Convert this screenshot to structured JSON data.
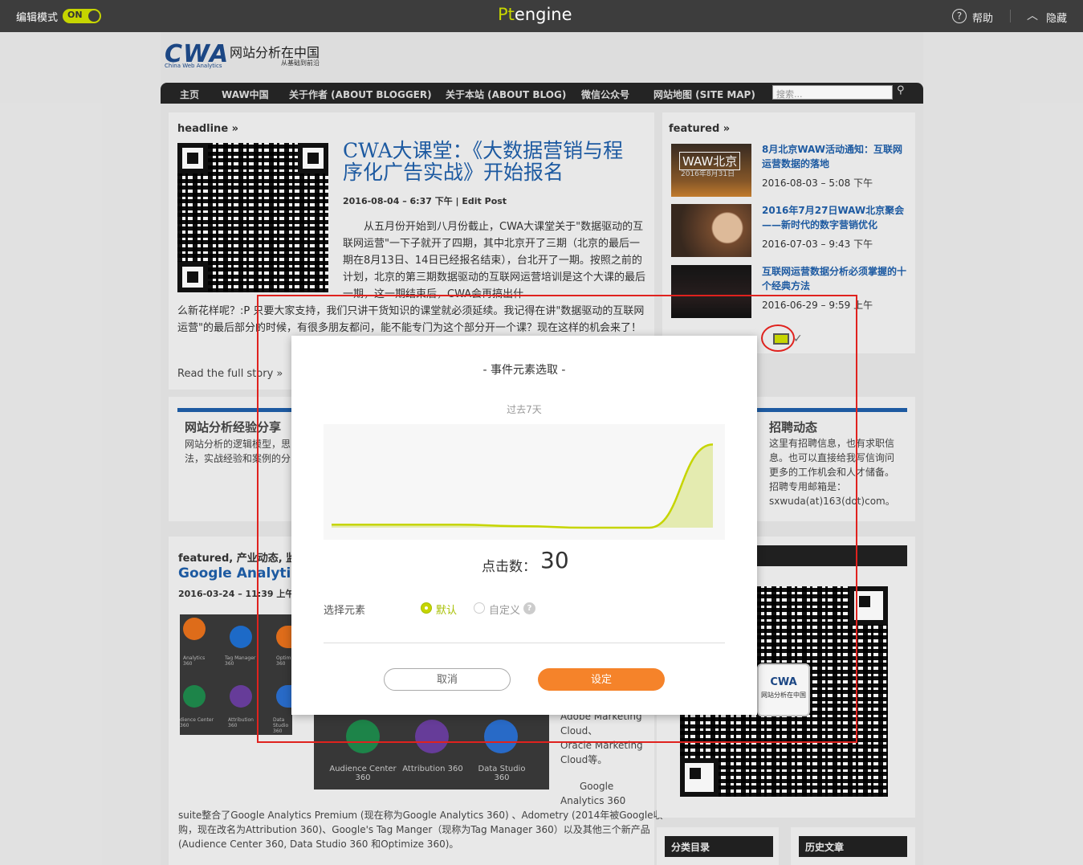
{
  "topbar": {
    "edit_label": "编辑模式",
    "toggle": "ON",
    "brand_pt": "Pt",
    "brand_engine": "engine",
    "help": "帮助",
    "hide": "隐藏",
    "accent": "#c6d500"
  },
  "site": {
    "logo_cwa": "CWA",
    "logo_sub": "China Web Analytics",
    "logo_cn": "网站分析在中国",
    "logo_tag": "从基础到前沿",
    "nav": [
      "主页",
      "WAW中国",
      "关于作者 (ABOUT BLOGGER)",
      "关于本站 (ABOUT BLOG)",
      "微信公众号",
      "网站地图 (SITE MAP)"
    ],
    "search_placeholder": "搜索..."
  },
  "headline": {
    "section": "headline »",
    "title": "CWA大课堂：《大数据营销与程序化广告实战》开始报名",
    "meta": "2016-08-04 – 6:37 下午 | Edit Post",
    "body1": "从五月份开始到八月份截止，CWA大课堂关于\"数据驱动的互联网运营\"一下子就开了四期，其中北京开了三期（北京的最后一期在8月13日、14日已经报名结束），台北开了一期。按照之前的计划，北京的第三期数据驱动的互联网运营培训是这个大课的最后一期，这一期结束后，CWA会再搞出什",
    "body2": "么新花样呢？:P 只要大家支持，我们只讲干货知识的课堂就必须延续。我记得在讲\"数据驱动的互联网运营\"的最后部分的时候，有很多朋友都问，能不能专门为这个部分开一个课？现在这样的机会来了！",
    "read_more": "Read the full story »"
  },
  "featured": {
    "section": "featured »",
    "items": [
      {
        "title": "8月北京WAW活动通知：互联网运营数据的落地",
        "date": "2016-08-03 – 5:08 下午",
        "thumb_text": "WAW北京",
        "thumb_sub": "2016年8月31日"
      },
      {
        "title": "2016年7月27日WAW北京聚会——新时代的数字营销优化",
        "date": "2016-07-03 – 9:43 下午"
      },
      {
        "title": "互联网运营数据分析必须掌握的十个经典方法",
        "date": "2016-06-29 – 9:59 上午"
      }
    ]
  },
  "middle": {
    "left_title": "网站分析经验分享",
    "left_text1": "网站分析的逻辑模型，思",
    "left_text2": "法，实战经验和案例的分",
    "right_title": "招聘动态",
    "right_text": [
      "这里有招聘信息，也有求职信",
      "息。也可以直接给我写信询问",
      "更多的工作机会和人才储备。",
      "招聘专用邮箱是：",
      "sxwuda(at)163(dot)com。"
    ]
  },
  "lower": {
    "cat_line": "featured, 产业动态, 监",
    "title": "Google Analytics",
    "meta": "2016-03-24 – 11:39 上午",
    "tiles_small": [
      "Analytics 360",
      "Tag Manager 360",
      "Optim 360",
      "dience Center 360",
      "Attribution 360",
      "Data Studio 360"
    ],
    "tiles_big": [
      "Audience Center 360",
      "Attribution 360",
      "Data Studio 360"
    ],
    "side_text": [
      "Adobe Marketing",
      "Cloud、",
      "Oracle Marketing",
      "Cloud等。",
      "Google",
      "Analytics 360"
    ],
    "bottom_text": [
      "suite整合了Google Analytics Premium (现在称为Google Analytics 360) 、Adometry (2014年被Google收",
      "购，现在改名为Attribution 360)、Google's Tag Manger（现称为Tag Manager 360）以及其他三个新产品",
      "(Audience Center 360, Data Studio 360 和Optimize 360)。"
    ],
    "qr_center_cwa": "CWA",
    "qr_center_cn": "网站分析在中国",
    "bar_left": "分类目录",
    "bar_right": "历史文章"
  },
  "modal": {
    "title": "- 事件元素选取 -",
    "period": "过去7天",
    "click_label": "点击数：",
    "click_value": "30",
    "select_label": "选择元素",
    "option_default": "默认",
    "option_custom": "自定义",
    "help_mark": "?",
    "cancel": "取消",
    "confirm": "设定",
    "confirm_color": "#f5832a"
  },
  "chart_data": {
    "type": "area",
    "title": "",
    "x": [
      1,
      2,
      3,
      4,
      5,
      6,
      7
    ],
    "series": [
      {
        "values": [
          1,
          1,
          1,
          0.5,
          0,
          0,
          28
        ]
      }
    ],
    "ylim": [
      0,
      30
    ],
    "grid": false,
    "color": "#c6d500"
  }
}
